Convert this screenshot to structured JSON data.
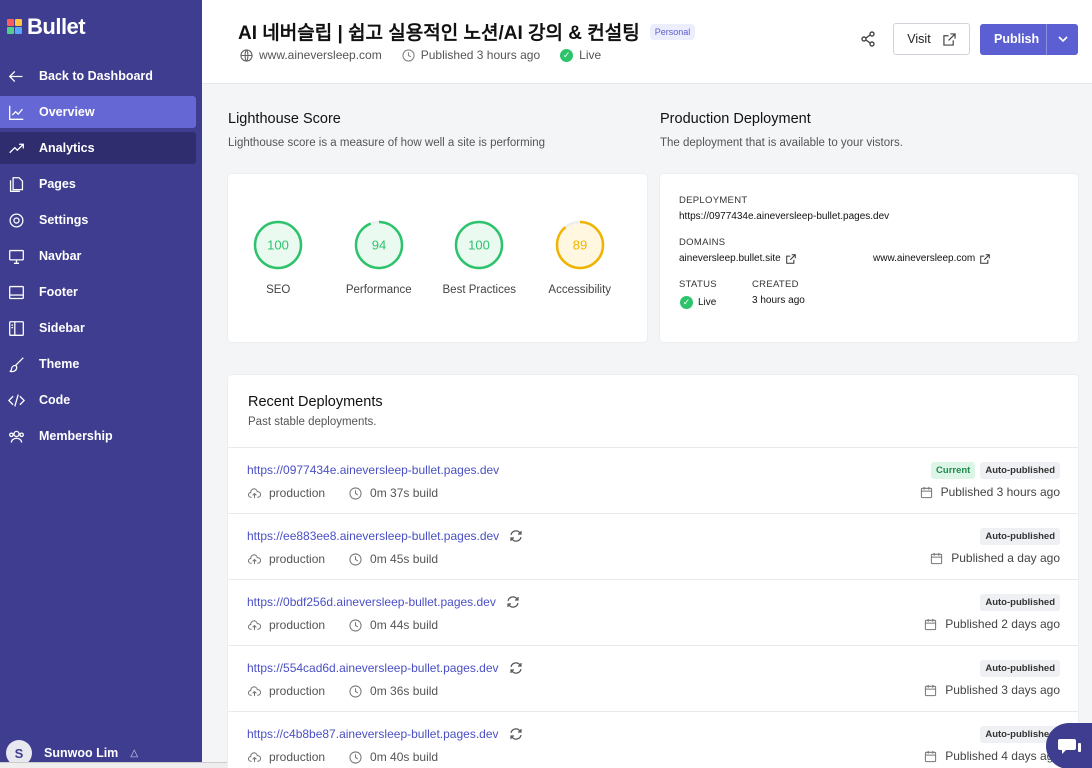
{
  "brand": {
    "name": "Bullet"
  },
  "sidebar": {
    "back": "Back to Dashboard",
    "items": [
      {
        "label": "Overview",
        "icon": "chart-icon"
      },
      {
        "label": "Analytics",
        "icon": "trend-icon"
      },
      {
        "label": "Pages",
        "icon": "pages-icon"
      },
      {
        "label": "Settings",
        "icon": "gear-icon"
      },
      {
        "label": "Navbar",
        "icon": "monitor-icon"
      },
      {
        "label": "Footer",
        "icon": "footer-icon"
      },
      {
        "label": "Sidebar",
        "icon": "sidebar-icon"
      },
      {
        "label": "Theme",
        "icon": "brush-icon"
      },
      {
        "label": "Code",
        "icon": "code-icon"
      },
      {
        "label": "Membership",
        "icon": "users-icon"
      }
    ],
    "user": {
      "initial": "S",
      "name": "Sunwoo Lim"
    }
  },
  "header": {
    "title": "AI 네버슬립 | 쉽고 실용적인 노션/AI 강의 & 컨설팅",
    "badge": "Personal",
    "domain": "www.aineversleep.com",
    "published": "Published 3 hours ago",
    "status": "Live",
    "visit": "Visit",
    "publish": "Publish"
  },
  "lighthouse": {
    "title": "Lighthouse Score",
    "subtitle": "Lighthouse score is a measure of how well a site is performing",
    "scores": [
      {
        "value": 100,
        "name": "SEO",
        "color": "#2cc36b"
      },
      {
        "value": 94,
        "name": "Performance",
        "color": "#2cc36b"
      },
      {
        "value": 100,
        "name": "Best Practices",
        "color": "#2cc36b"
      },
      {
        "value": 89,
        "name": "Accessibility",
        "color": "#f0b400"
      }
    ]
  },
  "production": {
    "title": "Production Deployment",
    "subtitle": "The deployment that is available to your vistors.",
    "deployment_label": "DEPLOYMENT",
    "deployment_url": "https://0977434e.aineversleep-bullet.pages.dev",
    "domains_label": "DOMAINS",
    "domain_1": "aineversleep.bullet.site",
    "domain_2": "www.aineversleep.com",
    "status_label": "STATUS",
    "status": "Live",
    "created_label": "CREATED",
    "created": "3 hours ago"
  },
  "recent": {
    "title": "Recent Deployments",
    "subtitle": "Past stable deployments.",
    "rows": [
      {
        "url": "https://0977434e.aineversleep-bullet.pages.dev",
        "env": "production",
        "build": "0m 37s build",
        "current": "Current",
        "auto": "Auto-published",
        "published": "Published 3 hours ago",
        "rollback": false
      },
      {
        "url": "https://ee883ee8.aineversleep-bullet.pages.dev",
        "env": "production",
        "build": "0m 45s build",
        "current": "",
        "auto": "Auto-published",
        "published": "Published a day ago",
        "rollback": true
      },
      {
        "url": "https://0bdf256d.aineversleep-bullet.pages.dev",
        "env": "production",
        "build": "0m 44s build",
        "current": "",
        "auto": "Auto-published",
        "published": "Published 2 days ago",
        "rollback": true
      },
      {
        "url": "https://554cad6d.aineversleep-bullet.pages.dev",
        "env": "production",
        "build": "0m 36s build",
        "current": "",
        "auto": "Auto-published",
        "published": "Published 3 days ago",
        "rollback": true
      },
      {
        "url": "https://c4b8be87.aineversleep-bullet.pages.dev",
        "env": "production",
        "build": "0m 40s build",
        "current": "",
        "auto": "Auto-published",
        "published": "Published 4 days ago",
        "rollback": true
      }
    ]
  },
  "colors": {
    "sidebar": "#3f3d8f",
    "accent": "#5b5fd1",
    "success": "#2cc36b",
    "warning": "#f0b400"
  }
}
